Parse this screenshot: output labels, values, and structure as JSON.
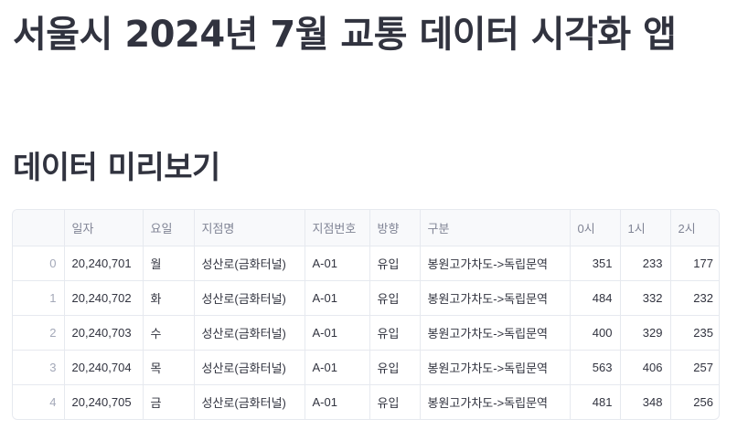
{
  "app": {
    "title": "서울시 2024년 7월 교통 데이터 시각화 앱"
  },
  "preview": {
    "title": "데이터 미리보기",
    "columns": [
      "",
      "일자",
      "요일",
      "지점명",
      "지점번호",
      "방향",
      "구분",
      "0시",
      "1시",
      "2시"
    ],
    "rows": [
      [
        "0",
        "20,240,701",
        "월",
        "성산로(금화터널)",
        "A-01",
        "유입",
        "봉원고가차도->독립문역",
        "351",
        "233",
        "177"
      ],
      [
        "1",
        "20,240,702",
        "화",
        "성산로(금화터널)",
        "A-01",
        "유입",
        "봉원고가차도->독립문역",
        "484",
        "332",
        "232"
      ],
      [
        "2",
        "20,240,703",
        "수",
        "성산로(금화터널)",
        "A-01",
        "유입",
        "봉원고가차도->독립문역",
        "400",
        "329",
        "235"
      ],
      [
        "3",
        "20,240,704",
        "목",
        "성산로(금화터널)",
        "A-01",
        "유입",
        "봉원고가차도->독립문역",
        "563",
        "406",
        "257"
      ],
      [
        "4",
        "20,240,705",
        "금",
        "성산로(금화터널)",
        "A-01",
        "유입",
        "봉원고가차도->독립문역",
        "481",
        "348",
        "256"
      ]
    ]
  }
}
